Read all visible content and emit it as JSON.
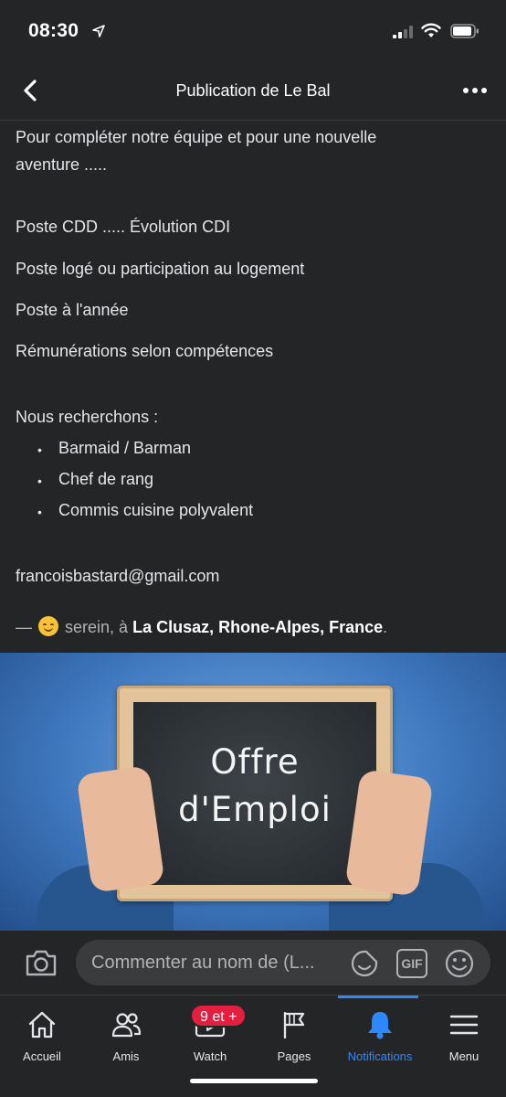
{
  "status_bar": {
    "time": "08:30"
  },
  "header": {
    "title": "Publication de Le Bal"
  },
  "post": {
    "intro_line1": "Pour compléter notre équipe et pour une nouvelle",
    "intro_line2": "aventure .....",
    "lines": [
      "Poste CDD ..... Évolution CDI",
      "Poste logé ou participation au logement",
      "Poste à l'année",
      "Rémunérations selon compétences"
    ],
    "search_heading": "Nous recherchons :",
    "positions": [
      "Barmaid / Barman",
      "Chef de rang",
      "Commis cuisine polyvalent"
    ],
    "email": "francoisbastard@gmail.com",
    "feeling": {
      "prefix": "—",
      "mood": "serein, à",
      "location": "La Clusaz, Rhone-Alpes, France",
      "suffix": "."
    }
  },
  "image": {
    "board_line1": "Offre",
    "board_line2": "d'Emploi"
  },
  "comment_bar": {
    "placeholder": "Commenter au nom de (L...",
    "gif_label": "GIF"
  },
  "bottom_nav": {
    "items": [
      {
        "label": "Accueil",
        "icon": "home-icon"
      },
      {
        "label": "Amis",
        "icon": "friends-icon"
      },
      {
        "label": "Watch",
        "icon": "watch-icon"
      },
      {
        "label": "Pages",
        "icon": "flag-icon"
      },
      {
        "label": "Notifications",
        "icon": "bell-icon"
      },
      {
        "label": "Menu",
        "icon": "hamburger-icon"
      }
    ],
    "watch_badge": "9 et +",
    "active": "Notifications",
    "accent_color": "#2d88ff",
    "badge_color": "#e41e3f"
  }
}
